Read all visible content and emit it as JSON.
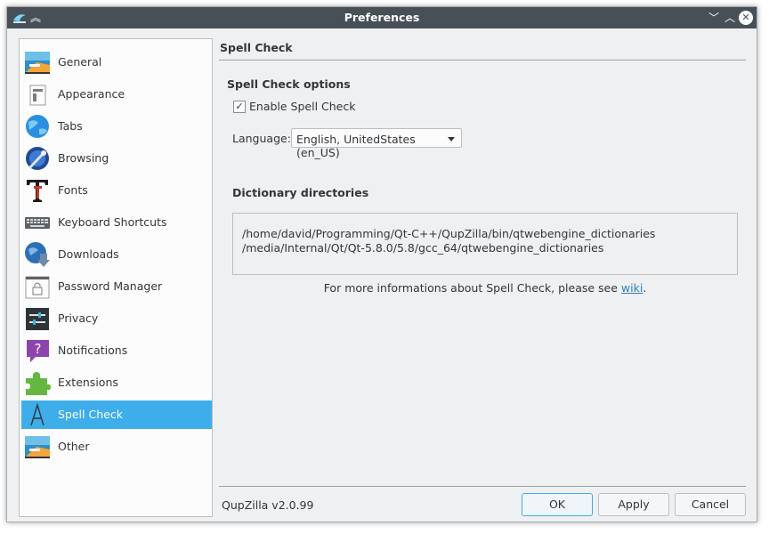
{
  "window": {
    "title": "Preferences"
  },
  "sidebar": {
    "items": [
      {
        "label": "General",
        "icon": "general-icon"
      },
      {
        "label": "Appearance",
        "icon": "appearance-icon"
      },
      {
        "label": "Tabs",
        "icon": "tabs-icon"
      },
      {
        "label": "Browsing",
        "icon": "browsing-icon"
      },
      {
        "label": "Fonts",
        "icon": "fonts-icon"
      },
      {
        "label": "Keyboard Shortcuts",
        "icon": "keyboard-icon"
      },
      {
        "label": "Downloads",
        "icon": "downloads-icon"
      },
      {
        "label": "Password Manager",
        "icon": "password-icon"
      },
      {
        "label": "Privacy",
        "icon": "privacy-icon"
      },
      {
        "label": "Notifications",
        "icon": "notifications-icon"
      },
      {
        "label": "Extensions",
        "icon": "extensions-icon"
      },
      {
        "label": "Spell Check",
        "icon": "spell-check-icon",
        "selected": true
      },
      {
        "label": "Other",
        "icon": "other-icon"
      }
    ]
  },
  "page": {
    "title": "Spell Check",
    "options_title": "Spell Check options",
    "enable_label": "Enable Spell Check",
    "enable_checked": true,
    "check_mark": "✓",
    "language_label": "Language:",
    "language_value": "English, UnitedStates (en_US)",
    "dictionary_title": "Dictionary directories",
    "directories": [
      "/home/david/Programming/Qt-C++/QupZilla/bin/qtwebengine_dictionaries",
      "/media/Internal/Qt/Qt-5.8.0/5.8/gcc_64/qtwebengine_dictionaries"
    ],
    "info_text": "For more informations about Spell Check, please see ",
    "info_link": "wiki",
    "info_suffix": "."
  },
  "footer": {
    "version": "QupZilla v2.0.99",
    "ok_label": "OK",
    "apply_label": "Apply",
    "cancel_label": "Cancel"
  },
  "colors": {
    "titlebar": "#475057",
    "selection": "#3daee9",
    "window_bg": "#eff0f1",
    "link": "#2980b9"
  }
}
